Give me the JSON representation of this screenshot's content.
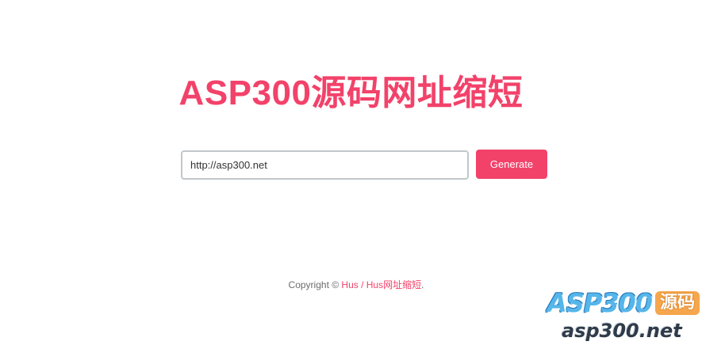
{
  "header": {
    "title": "ASP300源码网址缩短"
  },
  "form": {
    "url_value": "http://asp300.net",
    "generate_label": "Generate"
  },
  "footer": {
    "copyright_prefix": "Copyright © ",
    "link_text": "Hus / Hus网址缩短",
    "suffix": "."
  },
  "watermark": {
    "brand": "ASP300",
    "badge": "源码",
    "domain": "asp300.net"
  },
  "colors": {
    "accent": "#f2426a",
    "input_border": "#c2c7cc",
    "footer_text": "#6b6b6b"
  }
}
